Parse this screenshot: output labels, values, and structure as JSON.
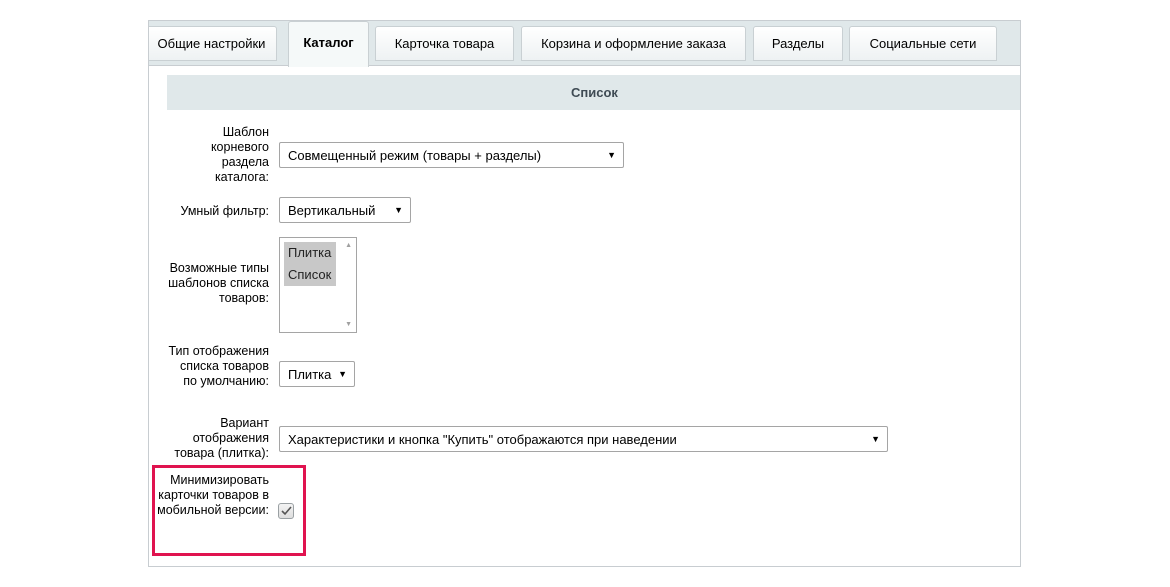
{
  "tabs": [
    {
      "label": "Общие настройки",
      "active": false
    },
    {
      "label": "Каталог",
      "active": true
    },
    {
      "label": "Карточка товара",
      "active": false
    },
    {
      "label": "Корзина и оформление заказа",
      "active": false
    },
    {
      "label": "Разделы",
      "active": false
    },
    {
      "label": "Социальные сети",
      "active": false
    }
  ],
  "section": {
    "title": "Список"
  },
  "fields": {
    "root_template": {
      "label": "Шаблон корневого раздела каталога:",
      "value": "Совмещенный режим (товары + разделы)"
    },
    "smart_filter": {
      "label": "Умный фильтр:",
      "value": "Вертикальный"
    },
    "list_templates": {
      "label": "Возможные типы шаблонов списка товаров:",
      "options": [
        "Плитка",
        "Список"
      ]
    },
    "default_view": {
      "label": "Тип отображения списка товаров по умолчанию:",
      "value": "Плитка"
    },
    "tile_variant": {
      "label": "Вариант отображения товара (плитка):",
      "value": "Характеристики и кнопка \"Купить\" отображаются при наведении"
    },
    "minimize_mobile": {
      "label": "Минимизировать карточки товаров в мобильной версии:",
      "checked": true
    }
  },
  "colors": {
    "highlight": "#e0134f",
    "tabbar_bg": "#e0e8ea"
  }
}
